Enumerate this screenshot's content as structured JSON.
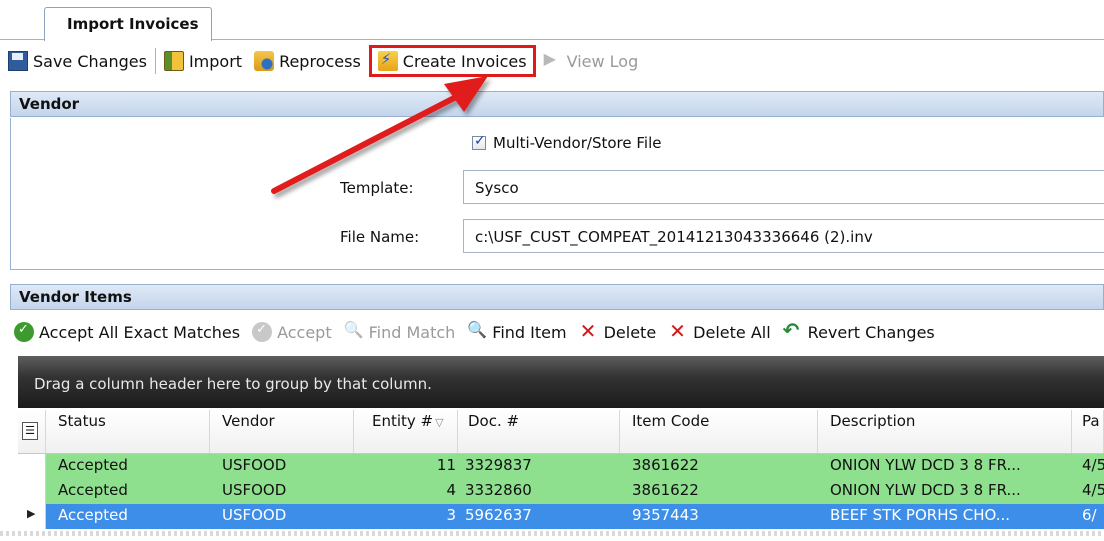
{
  "tab": {
    "label": "Import Invoices"
  },
  "toolbar": {
    "save_label": "Save Changes",
    "import_label": "Import",
    "reprocess_label": "Reprocess",
    "create_invoices_label": "Create Invoices",
    "view_log_label": "View Log"
  },
  "vendor": {
    "header": "Vendor",
    "multi_vendor_label": "Multi-Vendor/Store File",
    "multi_vendor_checked": true,
    "template_label": "Template:",
    "template_value": "Sysco",
    "file_name_label": "File Name:",
    "file_name_value": "c:\\USF_CUST_COMPEAT_20141213043336646 (2).inv"
  },
  "vendor_items": {
    "header": "Vendor Items",
    "toolbar": {
      "accept_all_label": "Accept All Exact Matches",
      "accept_label": "Accept",
      "find_match_label": "Find Match",
      "find_item_label": "Find Item",
      "delete_label": "Delete",
      "delete_all_label": "Delete All",
      "revert_label": "Revert Changes"
    },
    "group_hint": "Drag a column header here to group by that column.",
    "columns": {
      "status": "Status",
      "vendor": "Vendor",
      "entity": "Entity #",
      "doc": "Doc. #",
      "item_code": "Item Code",
      "description": "Description",
      "pack": "Pa"
    },
    "rows": [
      {
        "status": "Accepted",
        "vendor": "USFOOD",
        "entity": "11",
        "doc": "3329837",
        "item_code": "3861622",
        "description": "ONION  YLW DCD 3 8  FR...",
        "pack": "4/5"
      },
      {
        "status": "Accepted",
        "vendor": "USFOOD",
        "entity": "4",
        "doc": "3332860",
        "item_code": "3861622",
        "description": "ONION  YLW DCD 3 8  FR...",
        "pack": "4/5"
      },
      {
        "status": "Accepted",
        "vendor": "USFOOD",
        "entity": "3",
        "doc": "5962637",
        "item_code": "9357443",
        "description": "BEEF  STK PORHS CHO...",
        "pack": "6/"
      }
    ]
  },
  "colors": {
    "highlight_box": "#e01a1a",
    "arrow": "#e01a1a",
    "row_accepted": "#8ee08e",
    "row_selected": "#3d8ee8",
    "panel_header": "#c3d5ec"
  }
}
